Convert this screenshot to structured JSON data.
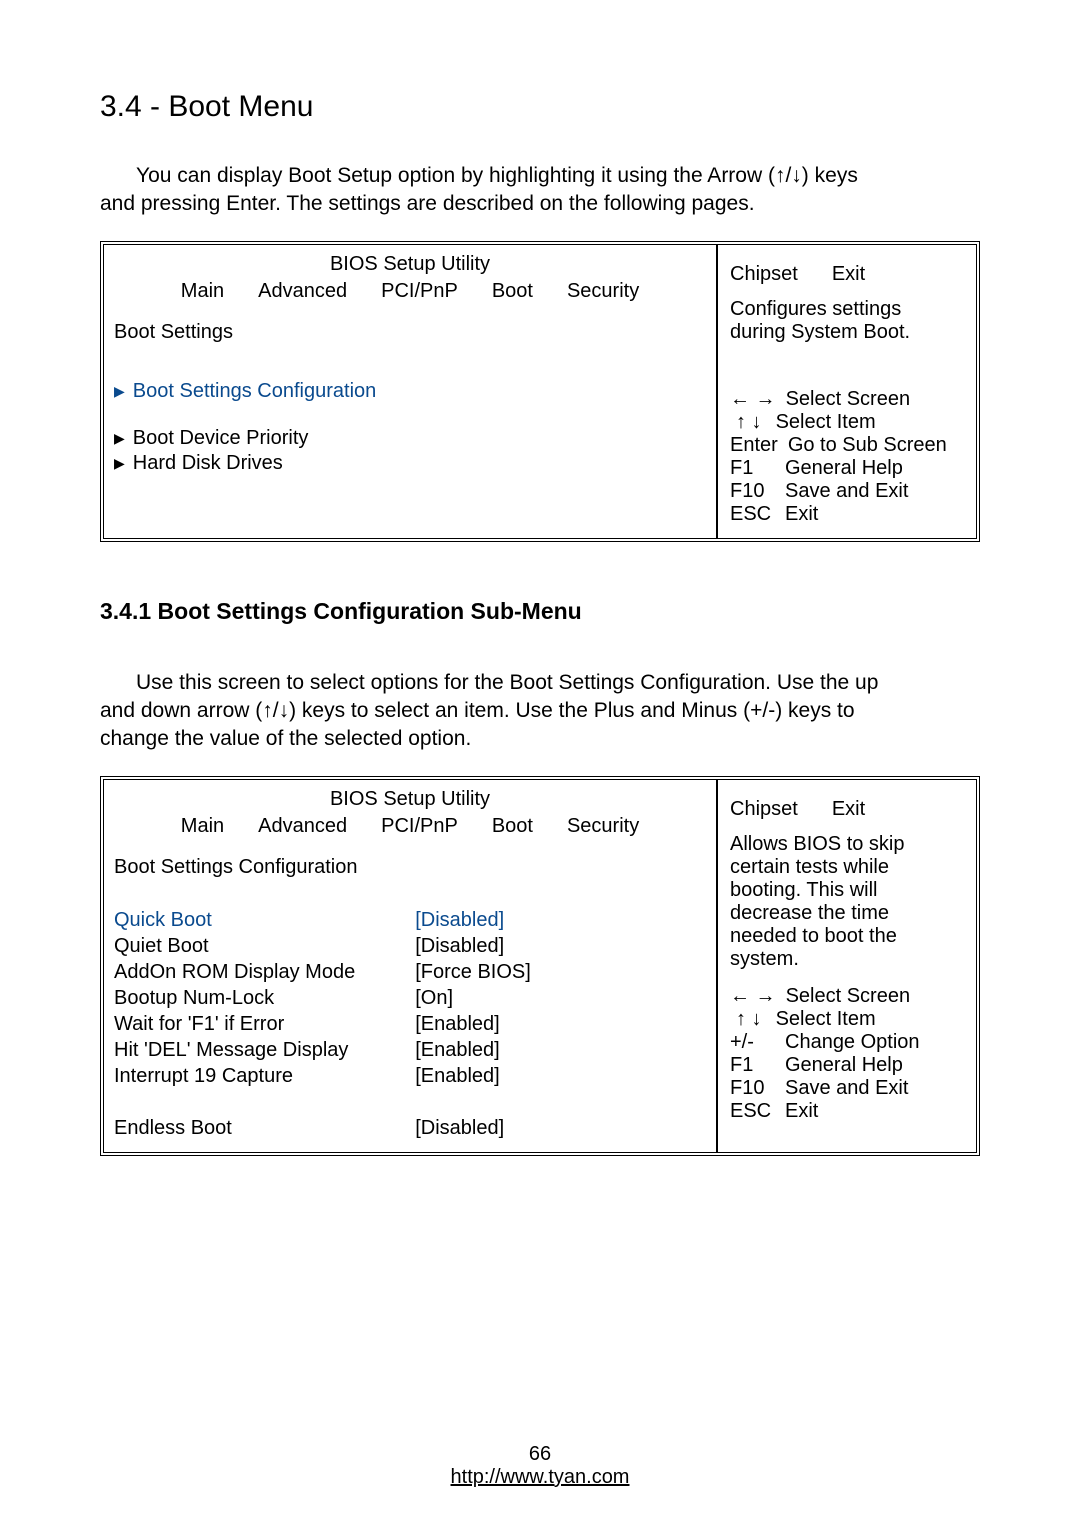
{
  "section": {
    "title": "3.4 - Boot Menu",
    "intro_line1": "You can display Boot Setup option by highlighting it using the Arrow (↑/↓) keys",
    "intro_line2": "and pressing Enter.  The settings are described on the following pages."
  },
  "bios1": {
    "header": "BIOS Setup Utility",
    "tabs": [
      "Main",
      "Advanced",
      "PCI/PnP",
      "Boot",
      "Security",
      "Chipset",
      "Exit"
    ],
    "left_title": "Boot Settings",
    "items": [
      {
        "label": "Boot Settings Configuration"
      },
      {
        "label": "Boot Device Priority"
      },
      {
        "label": "Hard Disk Drives"
      }
    ],
    "side_top1": "Configures settings",
    "side_top2": "during System Boot.",
    "help": [
      {
        "key": "← →",
        "desc": "Select Screen"
      },
      {
        "key": "↑ ↓",
        "desc": "Select Item"
      },
      {
        "key": "Enter",
        "desc": "Go to Sub Screen"
      },
      {
        "key": "F1",
        "desc": "General Help"
      },
      {
        "key": "F10",
        "desc": "Save and Exit"
      },
      {
        "key": "ESC",
        "desc": "Exit"
      }
    ]
  },
  "subsection": {
    "title": "3.4.1 Boot Settings Configuration Sub-Menu",
    "intro_line1": "Use this screen to select options for the Boot Settings Configuration. Use the up",
    "intro_line2": "and down arrow (↑/↓) keys to select an item. Use the Plus and Minus (+/-) keys to",
    "intro_line3": "change the value of the selected option."
  },
  "bios2": {
    "header": "BIOS Setup Utility",
    "tabs": [
      "Main",
      "Advanced",
      "PCI/PnP",
      "Boot",
      "Security",
      "Chipset",
      "Exit"
    ],
    "left_title": "Boot Settings Configuration",
    "settings": [
      {
        "label": "Quick Boot",
        "value": "[Disabled]",
        "selected": true
      },
      {
        "label": "Quiet Boot",
        "value": "[Disabled]",
        "selected": false
      },
      {
        "label": "AddOn ROM Display Mode",
        "value": "[Force BIOS]",
        "selected": false
      },
      {
        "label": "Bootup Num-Lock",
        "value": "[On]",
        "selected": false
      },
      {
        "label": "Wait for 'F1' if Error",
        "value": "[Enabled]",
        "selected": false
      },
      {
        "label": "Hit 'DEL' Message Display",
        "value": "[Enabled]",
        "selected": false
      },
      {
        "label": "Interrupt 19 Capture",
        "value": "[Enabled]",
        "selected": false
      }
    ],
    "endless": {
      "label": "Endless Boot",
      "value": "[Disabled]"
    },
    "side_top": [
      "Allows BIOS to skip",
      "certain tests while",
      "booting.  This will",
      "decrease the time",
      "needed to boot the",
      "system."
    ],
    "help": [
      {
        "key": "← →",
        "desc": "Select Screen"
      },
      {
        "key": "↑ ↓",
        "desc": "Select Item"
      },
      {
        "key": "+/-",
        "desc": "Change Option"
      },
      {
        "key": "F1",
        "desc": "General Help"
      },
      {
        "key": "F10",
        "desc": "Save and Exit"
      },
      {
        "key": "ESC",
        "desc": "Exit"
      }
    ]
  },
  "footer": {
    "page": "66",
    "url": "http://www.tyan.com"
  }
}
